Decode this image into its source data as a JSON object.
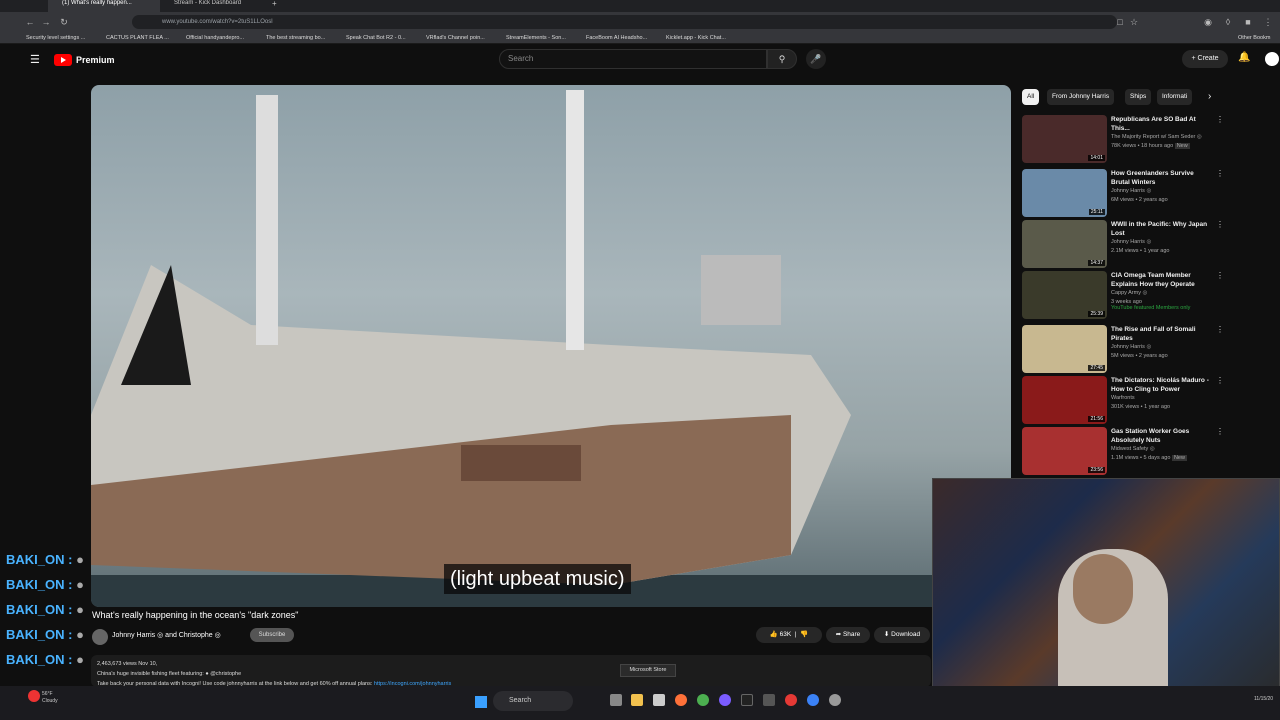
{
  "browser": {
    "tabs": [
      {
        "label": "(1) What's really happen..."
      },
      {
        "label": "Stream - Kick Dashboard"
      }
    ],
    "url": "www.youtube.com/watch?v=2tuS1LLOosl",
    "bookmarks": [
      "Security level settings ...",
      "CACTUS PLANT FLEA ...",
      "Official handyandepro...",
      "The best streaming bo...",
      "Speak Chat Bot R2 - 0...",
      "VRflad's Channel poin...",
      "StreamElements - Son...",
      "FaceBoom AI Headsho...",
      "Kicklet.app - Kick Chat...",
      "Other Bookm"
    ]
  },
  "youtube": {
    "logo_text": "Premium",
    "search_placeholder": "Search",
    "create_label": "Create",
    "notification_count": "1"
  },
  "video": {
    "caption": "(light upbeat music)",
    "title": "What's really happening in the ocean's \"dark zones\"",
    "channel": "Johnny Harris ◎ and Christophe ◎",
    "subscribe": "Subscribe",
    "likes": "63K",
    "share": "Share",
    "download": "Download",
    "stats": "2,463,673 views  Nov 10,",
    "desc_line1": "China's huge invisible fishing fleet featuring: ● @christophe",
    "desc_line2": "Take back your personal data with Incogni! Use code johnnyharris at the link below and get 60% off annual plans: ",
    "desc_link": "https://incogni.com/johnnyharris"
  },
  "chips": [
    "All",
    "From Johnny Harris",
    "Ships",
    "Informati"
  ],
  "recommendations": [
    {
      "title": "Republicans Are SO Bad At This...",
      "channel": "The Majority Report w/ Sam Seder ◎",
      "meta": "78K views • 18 hours ago",
      "badge": "New",
      "duration": "14:01",
      "color": "#4a2a2a"
    },
    {
      "title": "How Greenlanders Survive Brutal Winters",
      "channel": "Johnny Harris ◎",
      "meta": "6M views • 2 years ago",
      "badge": "",
      "duration": "25:11",
      "color": "#6a8aa8"
    },
    {
      "title": "WWII in the Pacific: Why Japan Lost",
      "channel": "Johnny Harris ◎",
      "meta": "2.1M views • 1 year ago",
      "badge": "",
      "duration": "14:37",
      "color": "#5a5a4a"
    },
    {
      "title": "CIA Omega Team Member Explains How they Operate",
      "channel": "Cappy Army ◎",
      "meta": "3 weeks ago",
      "badge": "YouTube featured  Members only",
      "duration": "25:39",
      "color": "#3a3a2a"
    },
    {
      "title": "The Rise and Fall of Somali Pirates",
      "channel": "Johnny Harris ◎",
      "meta": "5M views • 2 years ago",
      "badge": "",
      "duration": "27:45",
      "color": "#c8b890"
    },
    {
      "title": "The Dictators: Nicolás Maduro - How to Cling to Power",
      "channel": "Warfronts",
      "meta": "301K views • 1 year ago",
      "badge": "",
      "duration": "21:56",
      "color": "#8a1a1a"
    },
    {
      "title": "Gas Station Worker Goes Absolutely Nuts",
      "channel": "Midwest Safety ◎",
      "meta": "1.1M views • 5 days ago",
      "badge": "New",
      "duration": "23:56",
      "color": "#a83030"
    }
  ],
  "chat": {
    "user": "BAKI_ON",
    "lines": 5
  },
  "taskbar": {
    "weather_temp": "56°F",
    "weather_desc": "Cloudy",
    "search": "Search",
    "tooltip": "Microsoft Store",
    "time": "11/15/20"
  }
}
